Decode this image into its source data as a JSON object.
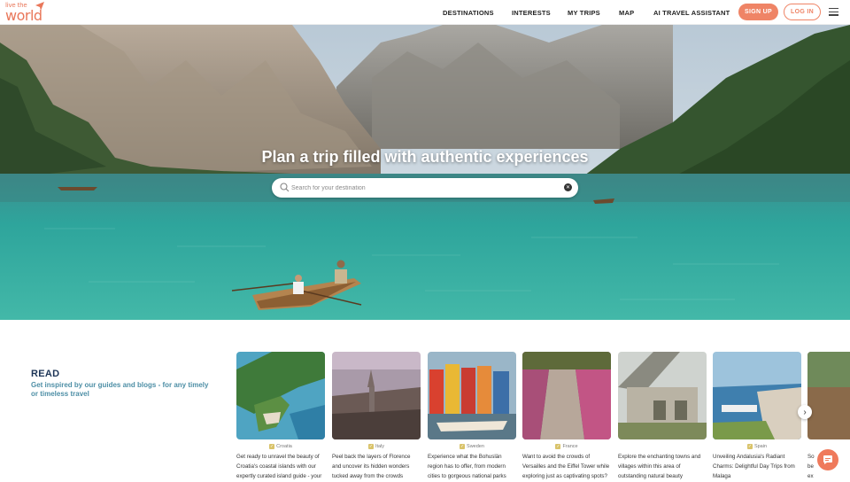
{
  "brand": {
    "logo_line1": "live the",
    "logo_line2": "world"
  },
  "nav": {
    "items": [
      "DESTINATIONS",
      "INTERESTS",
      "MY TRIPS",
      "MAP",
      "AI TRAVEL ASSISTANT"
    ],
    "signup": "SIGN UP",
    "login": "LOG IN"
  },
  "hero": {
    "title": "Plan a trip filled with authentic experiences",
    "search_placeholder": "Search for your destination"
  },
  "read": {
    "title": "READ",
    "subtitle": "Get inspired by our guides and blogs - for any timely or timeless travel"
  },
  "cards": [
    {
      "country": "Croatia",
      "desc": "Get ready to unravel the beauty of Croatia's coastal islands with our expertly curated island guide - your"
    },
    {
      "country": "Italy",
      "desc": "Peel back the layers of Florence and uncover its hidden wonders tucked away from the crowds"
    },
    {
      "country": "Sweden",
      "desc": "Experience what the Bohuslän region has to offer, from modern cities to gorgeous national parks"
    },
    {
      "country": "France",
      "desc": "Want to avoid the crowds of Versailles and the Eiffel Tower while exploring just as captivating spots?"
    },
    {
      "country": "",
      "desc": "Explore the enchanting towns and villages within this area of outstanding natural beauty"
    },
    {
      "country": "Spain",
      "desc": "Unveiling Andalusia's Radiant Charms: Delightful Day Trips from Malaga"
    },
    {
      "country": "",
      "desc": "So be ex"
    }
  ],
  "colors": {
    "accent": "#ef8466",
    "heading": "#1d3557",
    "subtitle": "#4e8fa6"
  },
  "icons": {
    "search": "search-icon",
    "clear": "clear-icon",
    "menu": "menu-icon",
    "chat": "chat-icon",
    "next": "chevron-right-icon"
  }
}
